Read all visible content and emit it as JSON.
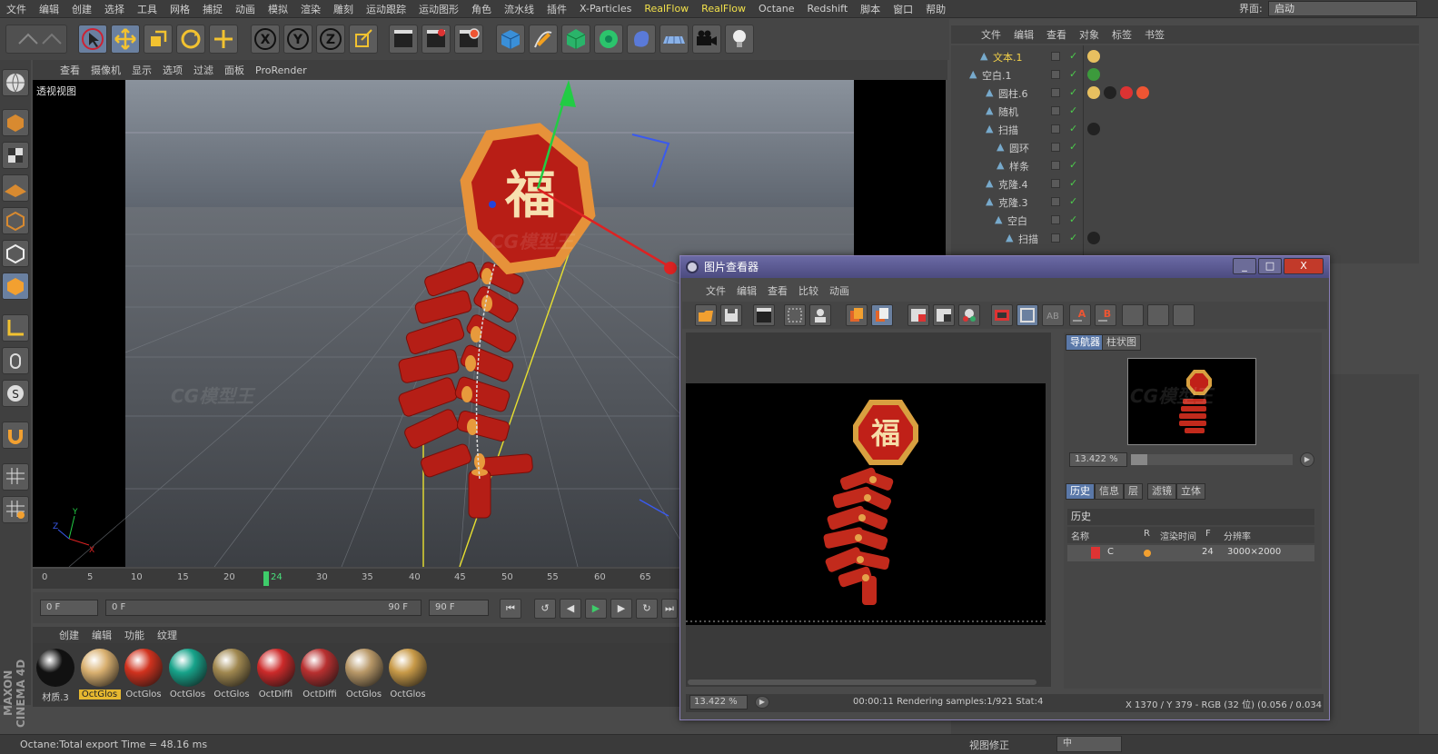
{
  "menubar": {
    "items": [
      "文件",
      "编辑",
      "创建",
      "选择",
      "工具",
      "网格",
      "捕捉",
      "动画",
      "模拟",
      "渲染",
      "雕刻",
      "运动跟踪",
      "运动图形",
      "角色",
      "流水线",
      "插件",
      "X-Particles",
      "RealFlow",
      "RealFlow",
      "Octane",
      "Redshift",
      "脚本",
      "窗口",
      "帮助"
    ],
    "interface_label": "界面:",
    "interface_value": "启动"
  },
  "toolbar": {
    "icons": [
      "undo-icon",
      "move-cursor-icon",
      "move-icon",
      "scale-icon",
      "rotate-icon",
      "world-axis-icon",
      "x-axis-icon",
      "y-axis-icon",
      "z-axis-icon",
      "coordinate-system-icon",
      "render-view-icon",
      "render-picture-viewer-icon",
      "render-settings-icon",
      "cube-icon",
      "pen-icon",
      "subdivision-icon",
      "cloner-icon",
      "deformer-icon",
      "floor-icon",
      "camera-icon",
      "light-icon"
    ],
    "axis_labels": [
      "X",
      "Y",
      "Z"
    ]
  },
  "viewport": {
    "menu": [
      "查看",
      "摄像机",
      "显示",
      "选项",
      "过滤",
      "面板",
      "ProRender"
    ],
    "label": "透视视图",
    "fu_char": "福",
    "axis": {
      "x": "X",
      "y": "Y",
      "z": "Z"
    }
  },
  "timeline": {
    "ticks": [
      "0",
      "5",
      "10",
      "15",
      "20",
      "24",
      "30",
      "35",
      "40",
      "45",
      "50",
      "55",
      "60",
      "65"
    ],
    "current": "24",
    "current_frame": 24,
    "start_field": "0 F",
    "range_start": "0 F",
    "range_end": "90 F",
    "end_field": "90 F"
  },
  "materials": {
    "menu": [
      "创建",
      "编辑",
      "功能",
      "纹理"
    ],
    "items": [
      {
        "name": "材质.3",
        "color": "#111111"
      },
      {
        "name": "OctGlos",
        "color": "#d9b070"
      },
      {
        "name": "OctGlos",
        "color": "#d0321e"
      },
      {
        "name": "OctGlos",
        "color": "#17a38a"
      },
      {
        "name": "OctGlos",
        "color": "#a08850"
      },
      {
        "name": "OctDiffi",
        "color": "#cc2a2a"
      },
      {
        "name": "OctDiffi",
        "color": "#b83030"
      },
      {
        "name": "OctGlos",
        "color": "#b89868"
      },
      {
        "name": "OctGlos",
        "color": "#c89a48"
      }
    ],
    "active_index": 1
  },
  "brand": {
    "line1": "MAXON",
    "line2": "CINEMA 4D"
  },
  "statusbar": {
    "text": "Octane:Total export Time = 48.16 ms"
  },
  "object_manager": {
    "menu": [
      "文件",
      "编辑",
      "查看",
      "对象",
      "标签",
      "书签"
    ],
    "rows": [
      {
        "name": "文本.1",
        "indent": 24,
        "hl": true
      },
      {
        "name": "空白.1",
        "indent": 12,
        "hl": false
      },
      {
        "name": "圆柱.6",
        "indent": 30,
        "hl": false
      },
      {
        "name": "随机",
        "indent": 30,
        "hl": false
      },
      {
        "name": "扫描",
        "indent": 30,
        "hl": false
      },
      {
        "name": "圆环",
        "indent": 42,
        "hl": false
      },
      {
        "name": "样条",
        "indent": 42,
        "hl": false
      },
      {
        "name": "克隆.4",
        "indent": 30,
        "hl": false
      },
      {
        "name": "克隆.3",
        "indent": 30,
        "hl": false
      },
      {
        "name": "空白",
        "indent": 40,
        "hl": false
      },
      {
        "name": "扫描",
        "indent": 52,
        "hl": false
      }
    ]
  },
  "attributes": {
    "label": "视图修正",
    "value": "中"
  },
  "picture_viewer": {
    "title": "图片查看器",
    "menu": [
      "文件",
      "编辑",
      "查看",
      "比较",
      "动画"
    ],
    "tabs_top": [
      "导航器",
      "柱状图"
    ],
    "zoom_top": "13.422 %",
    "tabs_bottom": [
      "历史",
      "信息",
      "层",
      "滤镜",
      "立体"
    ],
    "history_title": "历史",
    "history_headers": [
      "名称",
      "R",
      "渲染时间",
      "F",
      "分辨率"
    ],
    "history_row": {
      "name": "C",
      "frame": "24",
      "resolution": "3000×2000"
    },
    "zoom_bottom": "13.422 %",
    "status_text": "00:00:11 Rendering samples:1/921 Stat:4",
    "coords": "X 1370 / Y 379 - RGB (32 位) (0.056 / 0.034",
    "window_buttons": [
      "_",
      "□",
      "X"
    ]
  },
  "watermark": "CG模型王"
}
